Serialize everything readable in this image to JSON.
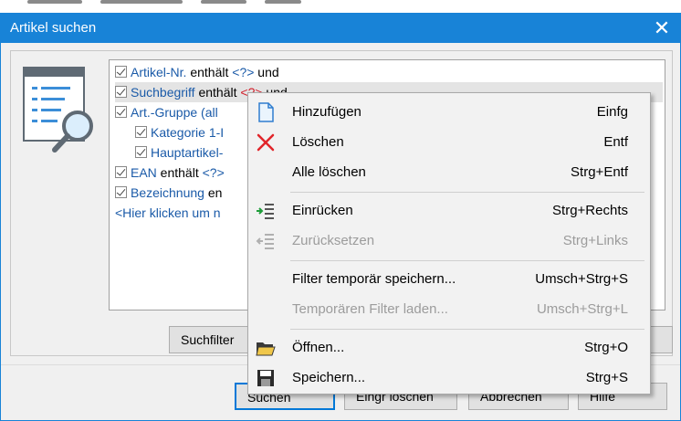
{
  "window": {
    "title": "Artikel suchen",
    "close_glyph": "✕"
  },
  "filter_rows": [
    {
      "field": "Artikel-Nr.",
      "op": " enthält ",
      "ph": "<?>",
      "tail": " und",
      "indent": 0
    },
    {
      "field": "Suchbegriff",
      "op": " enthält ",
      "ph": "<?>",
      "tail": " und",
      "indent": 0
    },
    {
      "field": "Art.-Gruppe (all",
      "op": "",
      "ph": "",
      "tail": "",
      "indent": 0
    },
    {
      "field": "Kategorie 1-I",
      "op": "",
      "ph": "",
      "tail": "",
      "indent": 1
    },
    {
      "field": "Hauptartikel-",
      "op": "",
      "ph": "",
      "tail": "",
      "indent": 1
    },
    {
      "field": "EAN",
      "op": " enthält ",
      "ph": "<?>",
      "tail": "",
      "indent": 0
    },
    {
      "field": "Bezeichnung",
      "op": " en",
      "ph": "",
      "tail": "",
      "indent": 0
    }
  ],
  "hint_row": "<Hier klicken um n",
  "buttons": {
    "suchfilter": "Suchfilter",
    "suchen": "Suchen",
    "eingabe_loeschen": "Eingr löschen",
    "abbrechen": "Abbrechen",
    "hilfe": "Hilfe"
  },
  "context_menu": [
    {
      "label": "Hinzufügen",
      "shortcut": "Einfg",
      "icon": "add-document-icon",
      "disabled": false
    },
    {
      "label": "Löschen",
      "shortcut": "Entf",
      "icon": "delete-x-icon",
      "disabled": false
    },
    {
      "label": "Alle löschen",
      "shortcut": "Strg+Entf",
      "icon": "",
      "disabled": false
    },
    {
      "label": "Einrücken",
      "shortcut": "Strg+Rechts",
      "icon": "indent-icon",
      "disabled": false
    },
    {
      "label": "Zurücksetzen",
      "shortcut": "Strg+Links",
      "icon": "outdent-icon",
      "disabled": true
    },
    {
      "label": "Filter temporär speichern...",
      "shortcut": "Umsch+Strg+S",
      "icon": "",
      "disabled": false
    },
    {
      "label": "Temporären Filter laden...",
      "shortcut": "Umsch+Strg+L",
      "icon": "",
      "disabled": true
    },
    {
      "label": "Öffnen...",
      "shortcut": "Strg+O",
      "icon": "open-folder-icon",
      "disabled": false
    },
    {
      "label": "Speichern...",
      "shortcut": "Strg+S",
      "icon": "save-disk-icon",
      "disabled": false
    }
  ],
  "colors": {
    "titlebar": "#1883d7",
    "field_link": "#1a5aa8",
    "placeholder_red": "#d21f2b",
    "disabled_text": "#9c9c9c"
  }
}
